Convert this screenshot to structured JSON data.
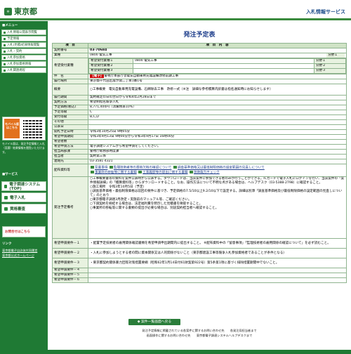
{
  "header": {
    "logo_mark": "⚬",
    "logo_text": "東京都",
    "service_title": "入札情報サービス"
  },
  "sidebar": {
    "menu_heading": "■メニュー",
    "items": [
      "入札情報公開表示閲覧",
      "予定情報",
      "入札(見積)結果情報閲覧",
      "入札・契約",
      "入札参加資格",
      "入札参加資格情報",
      "入札関連規程"
    ],
    "mobile_badge": "モバイル版はこちら",
    "mobile_note": "モバイル版は、発注予定情報と入札（見積）結果情報を閲覧いただけます。",
    "service_heading": "■サービス",
    "items2": [
      "電子調達システム(TOP)",
      "電子入札",
      "資格審査"
    ],
    "contact_label": "お問合せはこちら",
    "links_heading": "リンク",
    "links": [
      "東京都電子自治体共同運営",
      "東京都公式ホームページ"
    ]
  },
  "page": {
    "title": "発注予定表",
    "col_item": "項　目",
    "col_content": "項　目　内　容"
  },
  "record": {
    "contract_no_label": "契約番号",
    "contract_no": "03-70684",
    "category_label": "業種",
    "category": "0800 電気工事",
    "category_sub_label": "分野１",
    "desired_label": "希望受付業種",
    "desired": [
      {
        "name": "希望受付業種１",
        "value": "0800 電気工事",
        "sub": "分野１"
      },
      {
        "name": "希望受付業種２",
        "value": "",
        "sub": "分野２"
      },
      {
        "name": "希望受付業種３",
        "value": "",
        "sub": "分野３"
      }
    ],
    "subject_label": "件　名",
    "subject_tag": "【電子】",
    "subject": "警視庁本部庁舎電気自動車用充電設備改修前期工事",
    "location_label": "履行場所",
    "location": "東京都千代田区霞が関二丁目1番1号",
    "summary_label": "概要",
    "summary": "○工事概要　電気自動車用充電設備、石綿除去工事　改修一式（※注　詳細な参考積算内訳書は指名通知時にお知らせします）",
    "period_label": "履行期間",
    "period": "契約確定の日の翌日から令和4年2月28日まで",
    "method_label": "契約方法",
    "method": "希望制指名競争入札",
    "price_label": "予定価格(税込)",
    "price": "8,771,400円（消費税率10%）",
    "rank_label": "予定等級",
    "rank": "C",
    "rank_accept_label": "受付等級",
    "rank_accept": "B,C,D",
    "other_label": "その他",
    "other": "",
    "public_date_label": "公表日",
    "public_date": "",
    "open_date_label": "開札予定日時",
    "open_date": "令和3年10月25日 9時05分",
    "accept_period_label": "希望申請期間",
    "accept_period": "令和3年9月13日 9時00分から令和3年9月17日 16時00分",
    "accept_method_label": "希望者数",
    "accept_method": "",
    "accept_how_label": "希望申請方法",
    "accept_how": "電子調達システムから希望申請をしてください。",
    "dept_label": "担当局部課",
    "dept": "警視庁総務部用度課",
    "person_label": "担当者",
    "person": "契約第三係",
    "tel_label": "連絡先",
    "tel": "03-3581-4321",
    "files_label": "配布資料等",
    "files": [
      "案書事項",
      "監理技術者等の資格欠格の確認について",
      "調査基準価格又は最低制限価格の設定範囲の見直しについて",
      "事業所の移転等に関する書類",
      "工事履歴等の提出に関する書類",
      "技術能力チェック"
    ],
    "notes_label": "発注予定備考",
    "notes": [
      "○工事概要書等の資料を案件公表時から公表する。ダウンロードは、当該案件に参加できる者のみが行うことができる。ICカードで電子入札にログインを行い、当該案件の「案件情報詳細」の「積算資料等」からダウンロードすること。なお、操作方法について不明な点がある場合は、ヘルプデスク（03-5388-2798）に確認すること。",
      "○施工場所　令和3年10月5日（予定）",
      "○調査基準価格・最低制限価格は前回の要件に基づき、予定価格の7.5/10以上9.2/10以下で設定する。詳細は別添「調査基準価格及び最低制限価格の設定範囲の見直しについて」のとおり",
      "○東京都電子調達3月改定・実施前のマニュアル等、ご確認ください。",
      "○下請契約を締結する場合は、法定福利費を明示した見積書を徴取すること。",
      "○事業所の移転等に関する書類の提出が必要な場合は、別途契約担当者へ確認すること。"
    ],
    "cond_rows": [
      {
        "label": "希望申請要件－１",
        "text": "・配置予定技術者の雇用関係確認書類を希望申請申出期間内に提出すること。\n※配布資料中の「留意事項」「監理技術者の雇用関係の確認について」を必ず読むこと。"
      },
      {
        "label": "希望申請要件－２",
        "text": "・入札に参加しようとする者の間に資本関係又は人的関係がないこと（東京都建設工事等競争入札参加資格者であることが条件となる）"
      },
      {
        "label": "希望申請要件－３",
        "text": "・東京都契約関係暴力団等対策措置要綱（昭和62年1月14日付61財契第922号）第5条第1項に基づく排除措置期間中でないこと。"
      },
      {
        "label": "希望申請要件－４",
        "text": ""
      },
      {
        "label": "希望申請要件－５",
        "text": ""
      },
      {
        "label": "希望申請要件－６",
        "text": ""
      }
    ]
  },
  "back_button": "◆ 案件一覧画面へ戻る",
  "footer": {
    "line1": "発注予定情報に掲載されている各案件に関するお問い合わせ先　　各発注局担当者まで",
    "line2": "画面操作に関するお問い合わせ先　　東京都電子調達システムヘルプデスクまで"
  }
}
